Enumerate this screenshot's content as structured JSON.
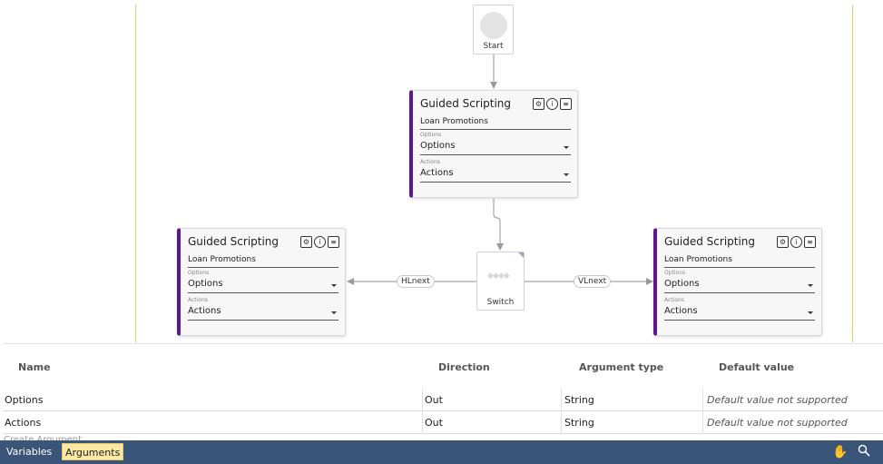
{
  "canvas": {
    "start_label": "Start",
    "nodes": [
      {
        "title": "Guided Scripting",
        "subtitle": "Loan Promotions",
        "options_small": "Options",
        "options_value": "Options",
        "actions_small": "Actions",
        "actions_value": "Actions"
      },
      {
        "title": "Guided Scripting",
        "subtitle": "Loan Promotions",
        "options_small": "Options",
        "options_value": "Options",
        "actions_small": "Actions",
        "actions_value": "Actions"
      },
      {
        "title": "Guided Scripting",
        "subtitle": "Loan Promotions",
        "options_small": "Options",
        "options_value": "Options",
        "actions_small": "Actions",
        "actions_value": "Actions"
      }
    ],
    "node_icons": [
      "settings-icon",
      "info-icon",
      "comment-icon"
    ],
    "switch_label": "Switch",
    "switch_diamonds": "◆◆◆◆",
    "edge_left": "HLnext",
    "edge_right": "VLnext",
    "accent_color": "#5b1a8c",
    "guide_line_color": "#f1c46b"
  },
  "arguments": {
    "headers": [
      "Name",
      "Direction",
      "Argument type",
      "Default value"
    ],
    "rows": [
      {
        "name": "Options",
        "direction": "Out",
        "type": "String",
        "default": "Default value not supported"
      },
      {
        "name": "Actions",
        "direction": "Out",
        "type": "String",
        "default": "Default value not supported"
      }
    ],
    "create_label": "Create Argument"
  },
  "bottombar": {
    "tabs": [
      "Variables",
      "Arguments"
    ],
    "active_tab": "Arguments",
    "icons": [
      "pan-hand-icon",
      "zoom-search-icon"
    ],
    "bar_color": "#3b5579"
  }
}
